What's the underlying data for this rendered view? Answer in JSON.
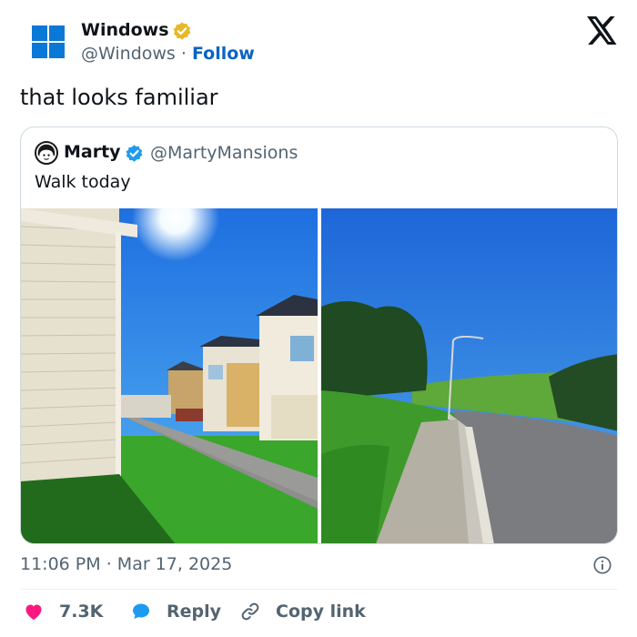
{
  "author": {
    "name": "Windows",
    "handle": "@Windows",
    "separator": "·",
    "follow_label": "Follow"
  },
  "icons": {
    "logo": "windows-logo-icon",
    "verified_author": "verified-gold-badge-icon",
    "platform": "x-logo-icon",
    "verified_quoted": "verified-blue-badge-icon",
    "info": "info-icon",
    "like": "heart-icon",
    "reply": "speech-bubble-icon",
    "copy": "link-icon"
  },
  "tweet": {
    "text": "that looks familiar"
  },
  "quote": {
    "name": "Marty",
    "handle": "@MartyMansions",
    "text": "Walk today",
    "photos": [
      {
        "subject": "houses-walkway-photo"
      },
      {
        "subject": "hill-road-photo"
      }
    ]
  },
  "meta": {
    "time": "11:06 PM",
    "separator": "·",
    "date": "Mar 17, 2025"
  },
  "actions": {
    "likes": "7.3K",
    "reply": "Reply",
    "copy_link": "Copy link"
  },
  "colors": {
    "follow": "#0a64c2",
    "windows_blue": "#0a78d7",
    "like": "#f91880",
    "verified_gold": "#e8b829",
    "verified_blue": "#1d9bf0",
    "muted_text": "#536471"
  }
}
